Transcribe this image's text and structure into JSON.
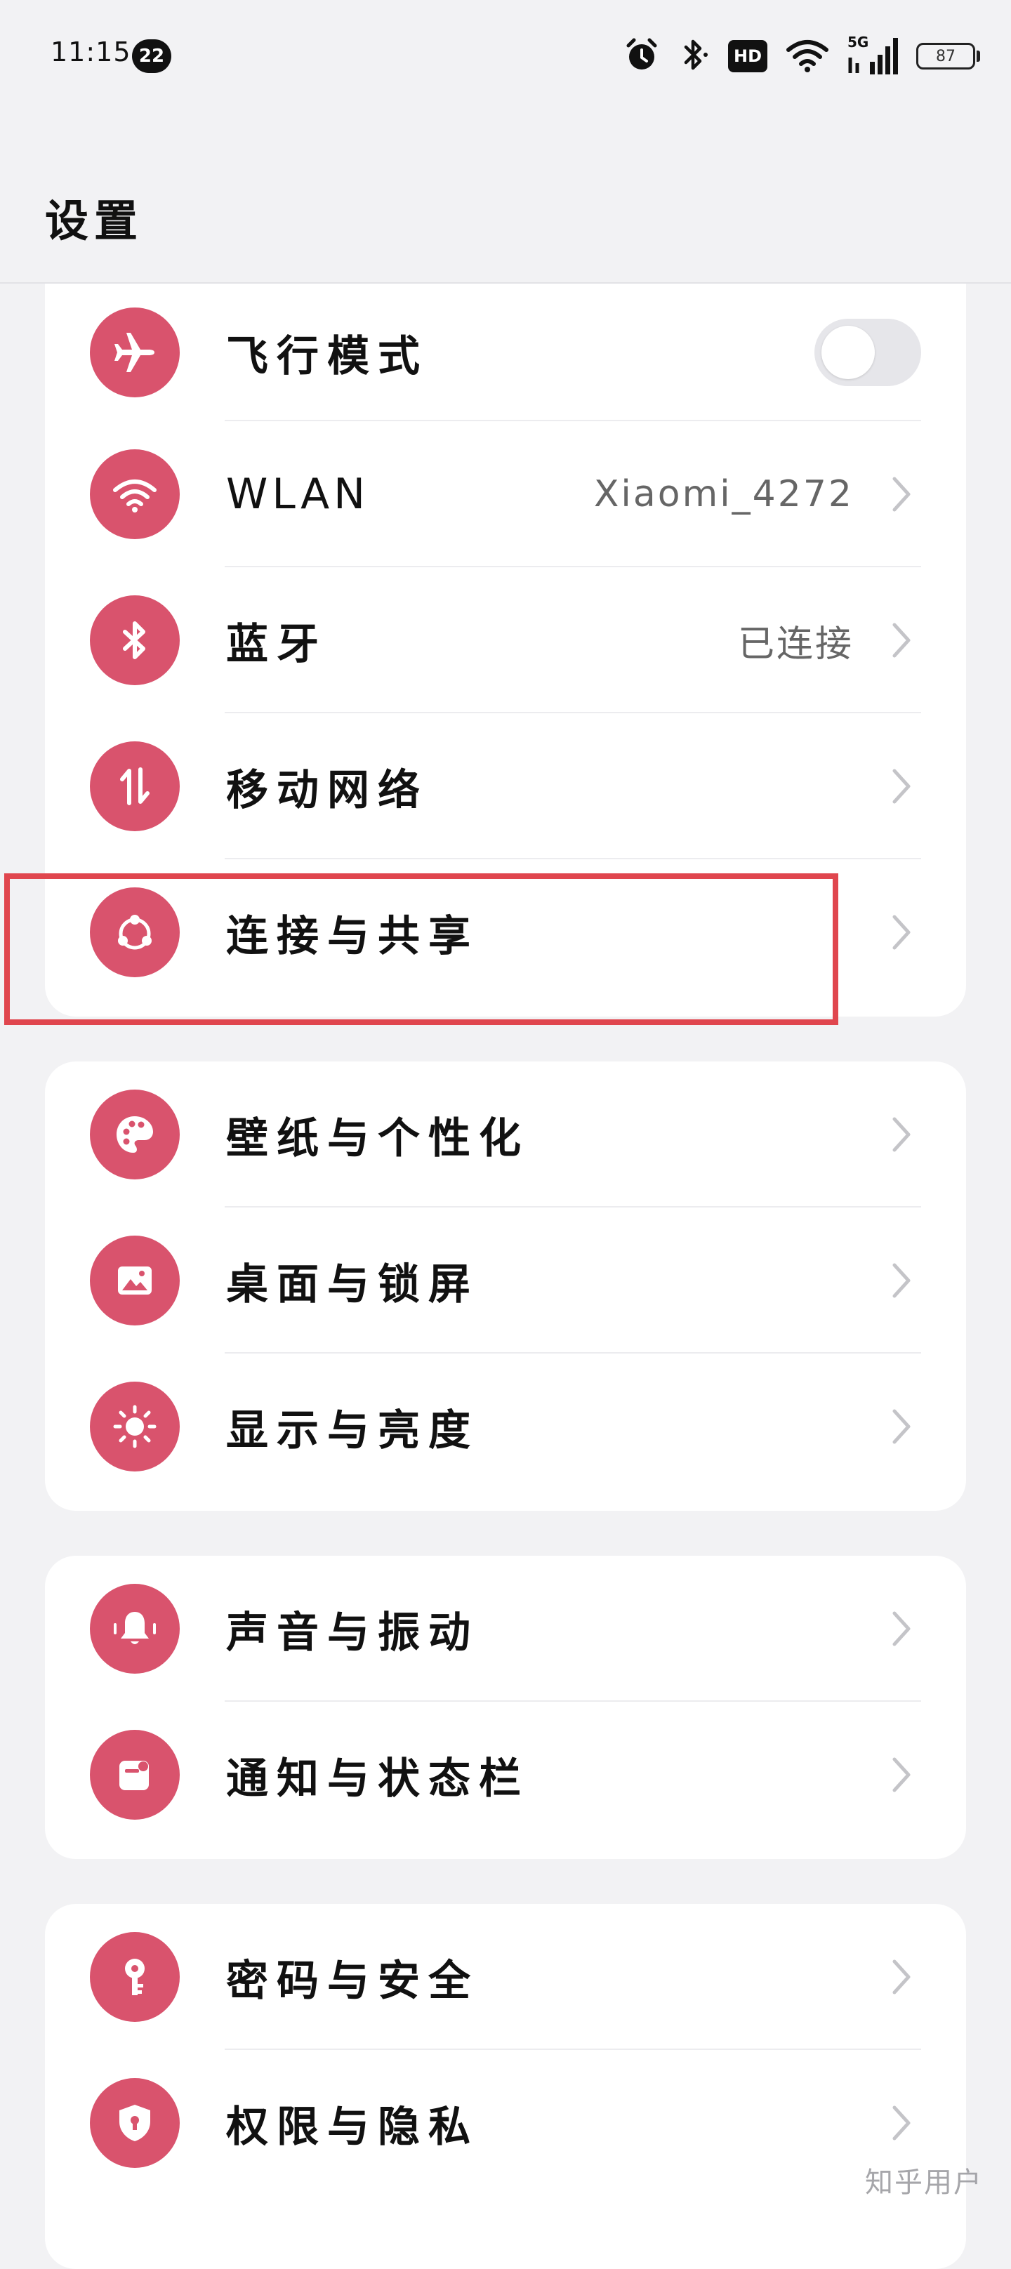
{
  "status_bar": {
    "time": "11:15",
    "notification_count": "22",
    "hd_label": "HD",
    "network_label": "5G",
    "battery_level": "87"
  },
  "header": {
    "title": "设置"
  },
  "colors": {
    "accent": "#d9536d",
    "highlight_box": "#e0464e",
    "background": "#f2f2f4"
  },
  "groups": [
    {
      "items": [
        {
          "label": "飞行模式",
          "icon": "airplane-icon",
          "toggle_on": false
        },
        {
          "label": "WLAN",
          "icon": "wifi-icon",
          "value": "Xiaomi_4272"
        },
        {
          "label": "蓝牙",
          "icon": "bluetooth-icon",
          "value": "已连接"
        },
        {
          "label": "移动网络",
          "icon": "mobile-data-icon"
        },
        {
          "label": "连接与共享",
          "icon": "share-icon"
        }
      ]
    },
    {
      "items": [
        {
          "label": "壁纸与个性化",
          "icon": "palette-icon"
        },
        {
          "label": "桌面与锁屏",
          "icon": "image-icon"
        },
        {
          "label": "显示与亮度",
          "icon": "sun-icon"
        }
      ]
    },
    {
      "items": [
        {
          "label": "声音与振动",
          "icon": "bell-icon"
        },
        {
          "label": "通知与状态栏",
          "icon": "notification-icon"
        }
      ]
    },
    {
      "items": [
        {
          "label": "密码与安全",
          "icon": "key-icon"
        },
        {
          "label": "权限与隐私",
          "icon": "shield-icon"
        }
      ]
    }
  ],
  "watermark": "知乎用户"
}
